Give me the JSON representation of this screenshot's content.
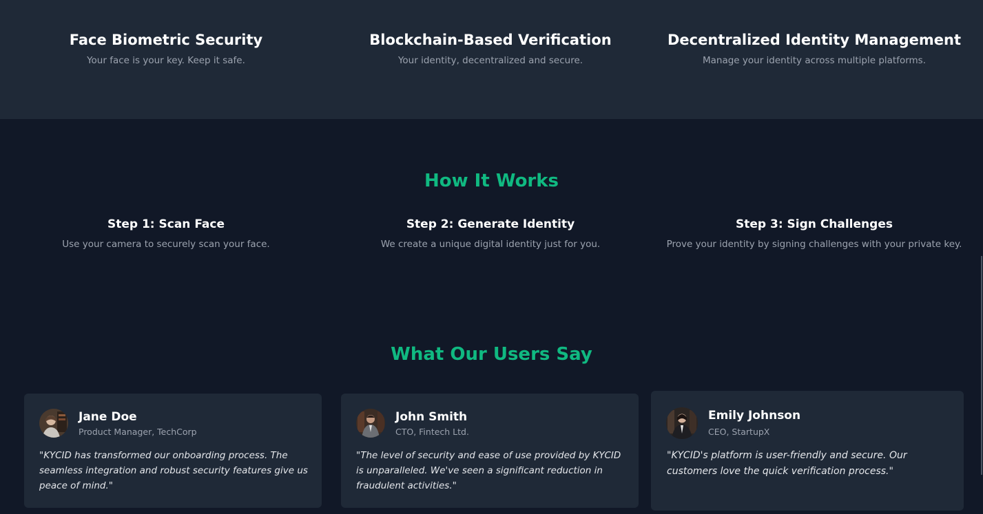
{
  "features": [
    {
      "title": "Face Biometric Security",
      "desc": "Your face is your key. Keep it safe."
    },
    {
      "title": "Blockchain-Based Verification",
      "desc": "Your identity, decentralized and secure."
    },
    {
      "title": "Decentralized Identity Management",
      "desc": "Manage your identity across multiple platforms."
    }
  ],
  "how_it_works": {
    "title": "How It Works",
    "steps": [
      {
        "title": "Step 1: Scan Face",
        "desc": "Use your camera to securely scan your face."
      },
      {
        "title": "Step 2: Generate Identity",
        "desc": "We create a unique digital identity just for you."
      },
      {
        "title": "Step 3: Sign Challenges",
        "desc": "Prove your identity by signing challenges with your private key."
      }
    ]
  },
  "testimonials": {
    "title": "What Our Users Say",
    "items": [
      {
        "name": "Jane Doe",
        "role": "Product Manager, TechCorp",
        "quote": "\"KYCID has transformed our onboarding process. The seamless integration and robust security features give us peace of mind.\""
      },
      {
        "name": "John Smith",
        "role": "CTO, Fintech Ltd.",
        "quote": "\"The level of security and ease of use provided by KYCID is unparalleled. We've seen a significant reduction in fraudulent activities.\""
      },
      {
        "name": "Emily Johnson",
        "role": "CEO, StartupX",
        "quote": "\"KYCID's platform is user-friendly and secure. Our customers love the quick verification process.\""
      }
    ]
  },
  "colors": {
    "page_bg": "#111827",
    "band_bg": "#1f2937",
    "accent": "#10b981",
    "muted_text": "#9ca3af"
  }
}
